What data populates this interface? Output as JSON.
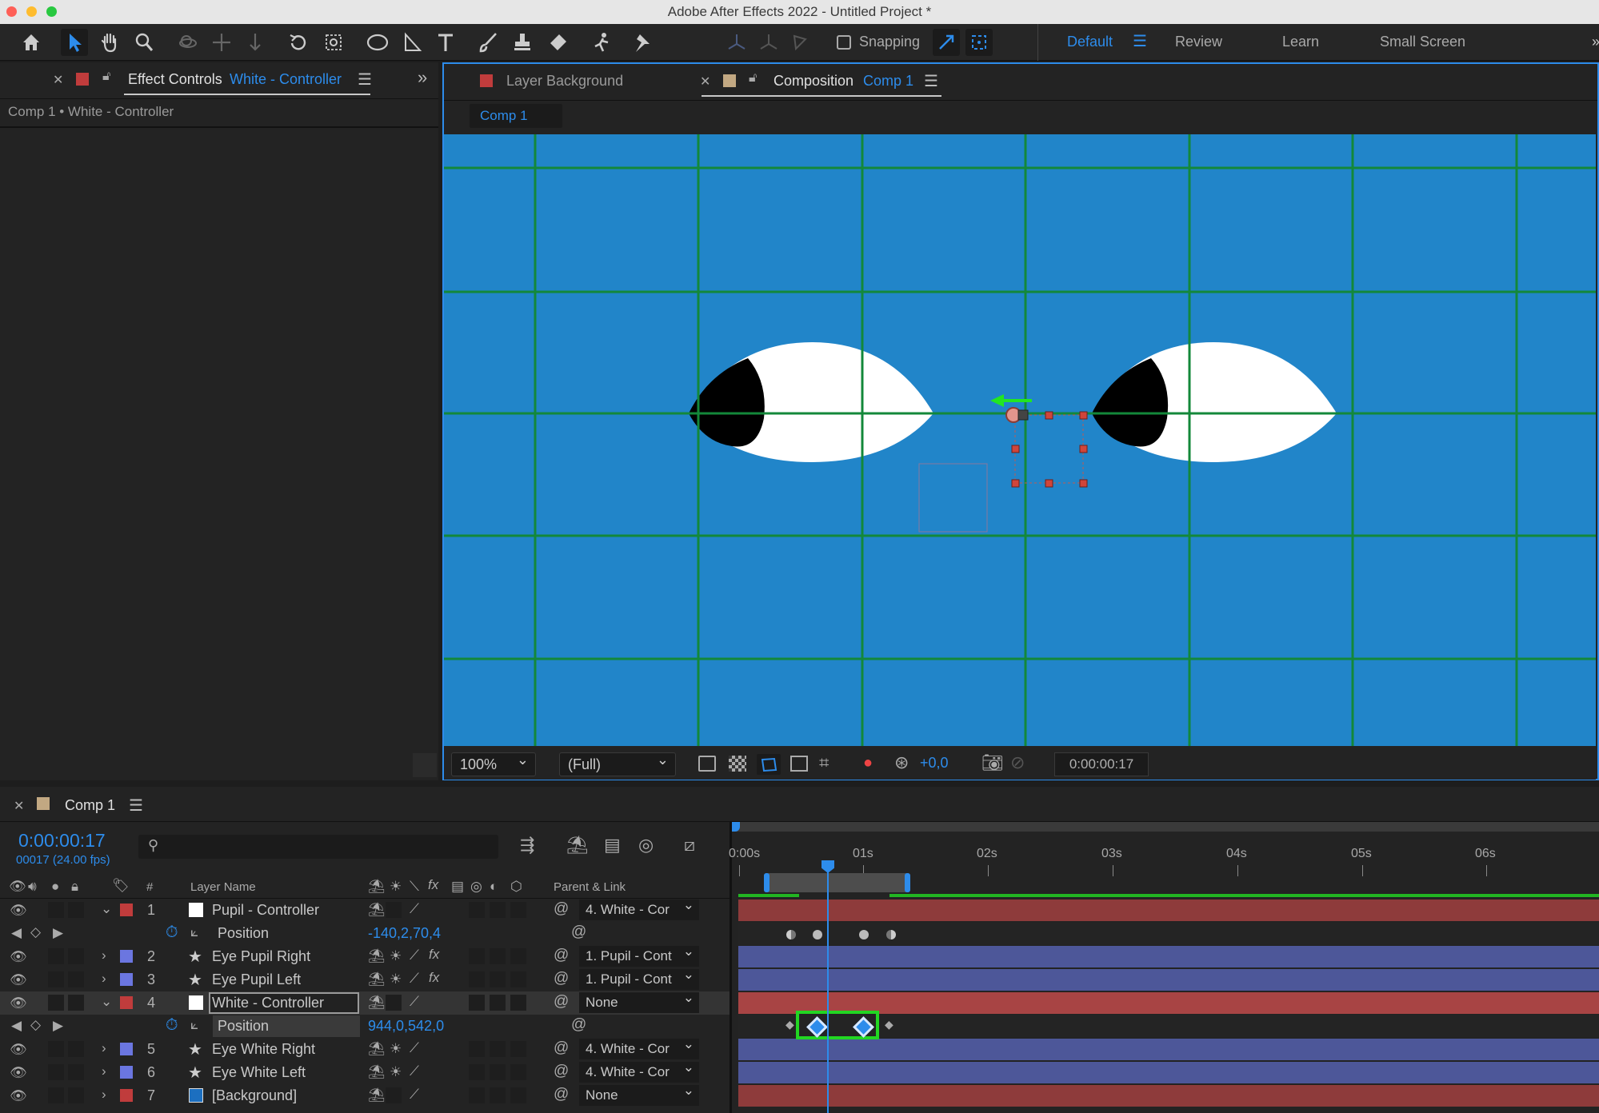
{
  "app": {
    "title": "Adobe After Effects 2022 - Untitled Project *"
  },
  "toolbar": {
    "snapping_label": "Snapping",
    "workspaces": [
      "Default",
      "Review",
      "Learn",
      "Small Screen"
    ]
  },
  "effect_controls": {
    "tab_label": "Effect Controls",
    "tab_target": "White - Controller",
    "breadcrumb": "Comp 1 • White - Controller"
  },
  "composition_panel": {
    "layer_tab": "Layer Background",
    "comp_tab_label": "Composition",
    "comp_tab_name": "Comp 1",
    "subtab": "Comp 1",
    "zoom": "100%",
    "resolution": "(Full)",
    "exposure": "+0,0",
    "timecode": "0:00:00:17"
  },
  "timeline": {
    "tab_label": "Comp 1",
    "current_time": "0:00:00:17",
    "frame_info": "00017 (24.00 fps)",
    "search_placeholder": "",
    "col_number": "#",
    "col_layer_name": "Layer Name",
    "col_parent": "Parent & Link",
    "ruler": [
      "0:00s",
      "01s",
      "02s",
      "03s",
      "04s",
      "05s",
      "06s"
    ],
    "layers": [
      {
        "num": "1",
        "name": "Pupil - Controller",
        "parent": "4. White - Cor",
        "label_color": "#c03c3c",
        "expanded": true,
        "property": "Position",
        "value": "-140,2,70,4"
      },
      {
        "num": "2",
        "name": "Eye Pupil Right",
        "parent": "1. Pupil - Cont",
        "label_color": "#6b76e0"
      },
      {
        "num": "3",
        "name": "Eye Pupil Left",
        "parent": "1. Pupil - Cont",
        "label_color": "#6b76e0"
      },
      {
        "num": "4",
        "name": "White - Controller",
        "parent": "None",
        "label_color": "#c03c3c",
        "expanded": true,
        "property": "Position",
        "value": "944,0,542,0"
      },
      {
        "num": "5",
        "name": "Eye White Right",
        "parent": "4. White - Cor",
        "label_color": "#6b76e0"
      },
      {
        "num": "6",
        "name": "Eye White Left",
        "parent": "4. White - Cor",
        "label_color": "#6b76e0"
      },
      {
        "num": "7",
        "name": "[Background]",
        "parent": "None",
        "label_color": "#c03c3c"
      }
    ]
  },
  "colors": {
    "accent": "#2d8ceb",
    "viewer_bg": "#2185c9",
    "grid": "#13883a",
    "highlight": "#22d622"
  }
}
